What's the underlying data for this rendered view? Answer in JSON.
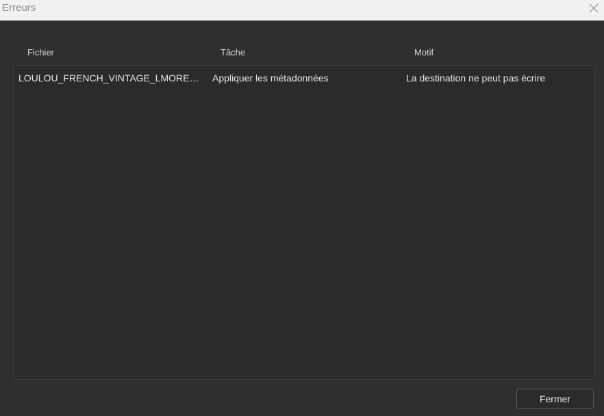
{
  "window": {
    "title": "Erreurs",
    "close_icon": "close-icon"
  },
  "table": {
    "columns": [
      "Fichier",
      "Tâche",
      "Motif"
    ],
    "rows": [
      {
        "file": "LOULOU_FRENCH_VINTAGE_LMOREL_V...",
        "task": "Appliquer les métadonnées",
        "reason": "La destination ne peut pas écrire"
      }
    ]
  },
  "footer": {
    "close_label": "Fermer"
  }
}
